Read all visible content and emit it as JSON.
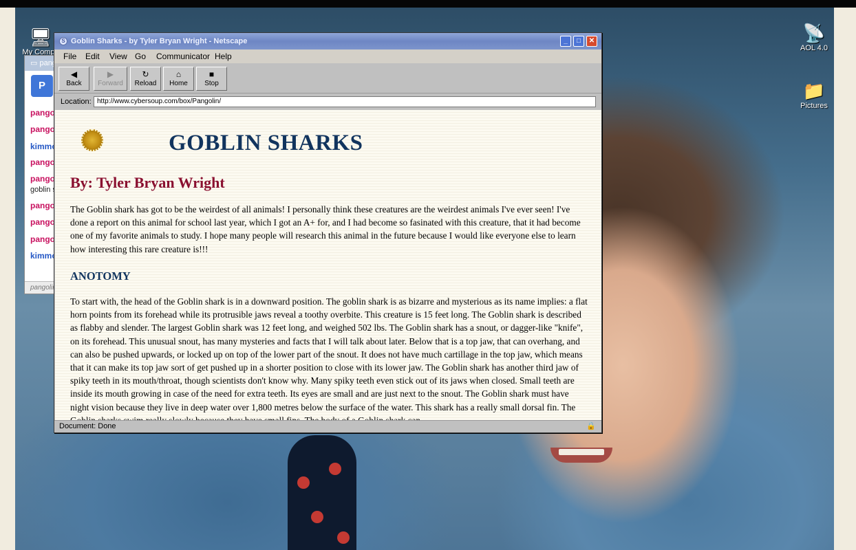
{
  "desktop": {
    "icons": [
      {
        "label": "My Compu",
        "glyph": "🖥"
      },
      {
        "label": "AOL 4.0",
        "glyph": "📡"
      },
      {
        "label": "Pictures",
        "glyph": "📁"
      }
    ]
  },
  "chat": {
    "title": "pang",
    "logo": "P",
    "rows": [
      "pango",
      "pango",
      "kimmo",
      "pango",
      "pango",
      "goblin s",
      "pango",
      "pango",
      "pango",
      "kimmo"
    ],
    "footer": "pangolin"
  },
  "window": {
    "title": "Goblin Sharks - by Tyler Bryan Wright - Netscape",
    "menu": [
      "File",
      "Edit",
      "View",
      "Go",
      "Communicator",
      "Help"
    ],
    "toolbar": {
      "back": "Back",
      "forward": "Forward",
      "reload": "Reload",
      "home": "Home",
      "stop": "Stop"
    },
    "location_label": "Location:",
    "url": "http://www.cybersoup.com/box/Pangolin/",
    "status": "Document: Done"
  },
  "page": {
    "title": "GOBLIN SHARKS",
    "byline": "By: Tyler Bryan Wright",
    "intro": "The Goblin shark has got to be the weirdest of all animals! I personally think these creatures are the weirdest animals I've ever seen! I've done a report on this animal for school last year, which I got an A+ for, and I had become so fasinated with this creature, that it had become one of my favorite animals to study. I hope many people will research this animal in the future because I would like everyone else to learn how interesting this rare creature is!!!",
    "section_heading": "ANOTOMY",
    "section_body": "To start with, the head of the Goblin shark is in a downward position. The goblin shark is as bizarre and mysterious as its name implies: a flat horn points from its forehead while its protrusible jaws reveal a toothy overbite. This creature is 15 feet long. The Goblin shark is described as flabby and slender. The largest Goblin shark was 12 feet long, and weighed 502 lbs. The Goblin shark has a snout, or dagger-like \"knife\", on its forehead. This unusual snout, has many mysteries and facts that I will talk about later. Below that is a top jaw, that can overhang, and can also be pushed upwards, or locked up on top of the lower part of the snout. It does not have much cartillage in the top jaw, which means that it can make its top jaw sort of get pushed up in a shorter position to close with its lower jaw. The Goblin shark has another third jaw of spiky teeth in its mouth/throat, though scientists don't know why. Many spiky teeth even stick out of its jaws when closed. Small teeth are inside its mouth growing in case of the need for extra teeth. Its eyes are small and are just next to the snout. The Goblin shark must have night vision because they live in deep water over 1,800 metres below the surface of the water. This shark has a really small dorsal fin. The Goblin sharks swim really slowly because they have small fins. The body of a Goblin shark can"
  }
}
